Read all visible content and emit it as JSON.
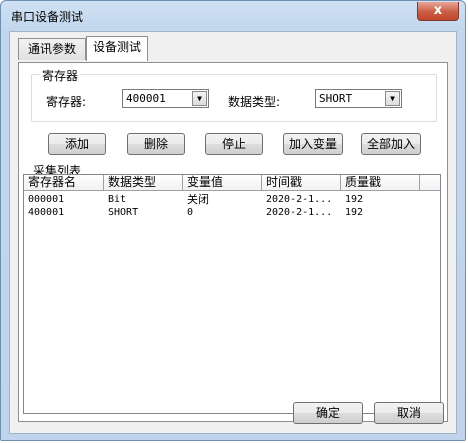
{
  "window": {
    "title": "串口设备测试",
    "close_glyph": "x"
  },
  "tabs": [
    {
      "label": "通讯参数"
    },
    {
      "label": "设备测试"
    }
  ],
  "group": {
    "label": "寄存器",
    "register_label": "寄存器:",
    "register_value": "400001",
    "datatype_label": "数据类型:",
    "datatype_value": "SHORT"
  },
  "buttons": {
    "add": "添加",
    "delete": "删除",
    "stop": "停止",
    "add_variable": "加入变量",
    "add_all": "全部加入"
  },
  "list": {
    "title": "采集列表",
    "columns": [
      "寄存器名",
      "数据类型",
      "变量值",
      "时间戳",
      "质量戳"
    ],
    "rows": [
      [
        "000001",
        "Bit",
        "关闭",
        "2020-2-1...",
        "192"
      ],
      [
        "400001",
        "SHORT",
        "0",
        "2020-2-1...",
        "192"
      ]
    ]
  },
  "footer": {
    "ok": "确定",
    "cancel": "取消"
  }
}
